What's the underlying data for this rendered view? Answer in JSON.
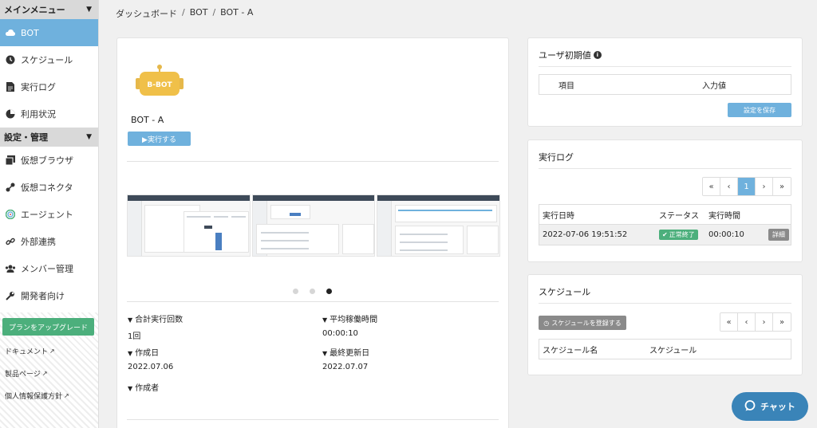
{
  "sidebar": {
    "section_main": "メインメニュー",
    "items_main": [
      {
        "label": "BOT",
        "icon": "cloud-icon"
      },
      {
        "label": "スケジュール",
        "icon": "clock-icon"
      },
      {
        "label": "実行ログ",
        "icon": "file-icon"
      },
      {
        "label": "利用状況",
        "icon": "pie-chart-icon"
      }
    ],
    "section_settings": "設定・管理",
    "items_settings": [
      {
        "label": "仮想ブラウザ",
        "icon": "browser-icon"
      },
      {
        "label": "仮想コネクタ",
        "icon": "connector-icon"
      },
      {
        "label": "エージェント",
        "icon": "agent-icon"
      },
      {
        "label": "外部連携",
        "icon": "link-icon"
      },
      {
        "label": "メンバー管理",
        "icon": "users-icon"
      },
      {
        "label": "開発者向け",
        "icon": "wrench-icon"
      }
    ],
    "upgrade_label": "プランをアップグレード",
    "links": [
      "ドキュメント",
      "製品ページ",
      "個人情報保護方針"
    ]
  },
  "breadcrumb": [
    "ダッシュボード",
    "BOT",
    "BOT - A"
  ],
  "bot": {
    "logo_text": "B-BOT",
    "name": "BOT - A",
    "run_label": "▶実行する",
    "carousel_active_index": 3,
    "stats": {
      "total_runs_label": "合計実行回数",
      "total_runs_value": "1回",
      "avg_time_label": "平均稼働時間",
      "avg_time_value": "00:00:10",
      "created_label": "作成日",
      "created_value": "2022.07.06",
      "updated_label": "最終更新日",
      "updated_value": "2022.07.07",
      "author_label": "作成者"
    }
  },
  "user_defaults": {
    "title": "ユーザ初期値",
    "col_item": "項目",
    "col_input": "入力値",
    "save_label": "設定を保存"
  },
  "exec_log": {
    "title": "実行ログ",
    "pager": [
      "«",
      "‹",
      "1",
      "›",
      "»"
    ],
    "col_date": "実行日時",
    "col_status": "ステータス",
    "col_time": "実行時間",
    "rows": [
      {
        "date": "2022-07-06 19:51:52",
        "status": "正常終了",
        "time": "00:00:10",
        "action": "詳細"
      }
    ]
  },
  "schedule": {
    "title": "スケジュール",
    "register_label": "スケジュールを登録する",
    "pager": [
      "«",
      "‹",
      "›",
      "»"
    ],
    "col_name": "スケジュール名",
    "col_schedule": "スケジュール"
  },
  "chat": {
    "label": "チャット"
  },
  "colors": {
    "accent": "#6fb1dd",
    "success": "#4caf7c",
    "chat": "#3a84b8"
  }
}
